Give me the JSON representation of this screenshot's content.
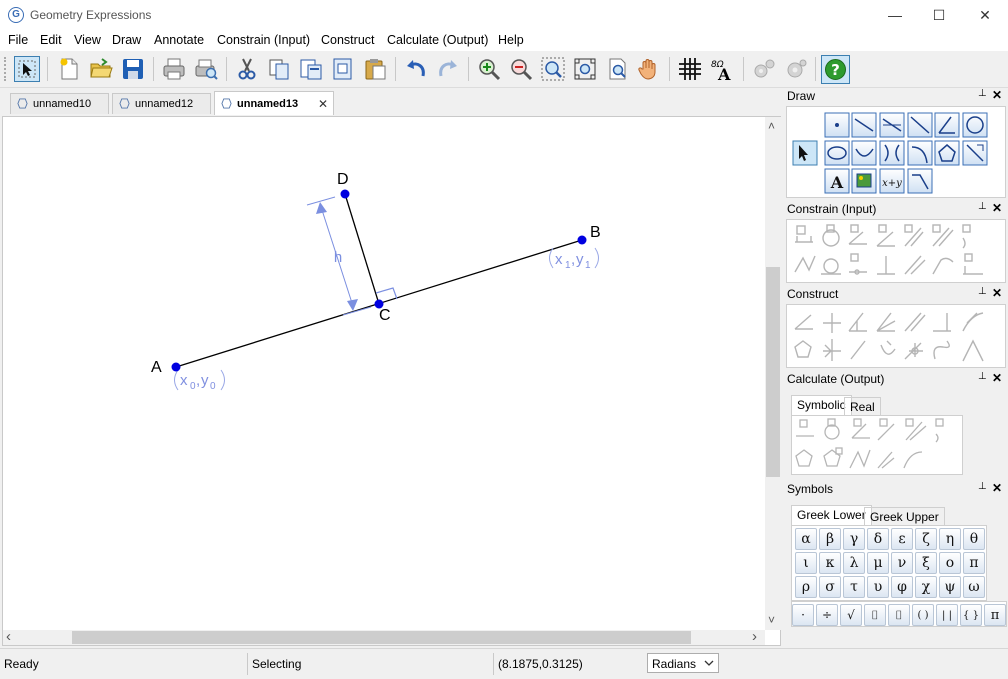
{
  "window": {
    "title": "Geometry Expressions",
    "minimize": "—",
    "maximize": "☐",
    "close": "✕",
    "app_icon_glyph": "G"
  },
  "menu": [
    "File",
    "Edit",
    "View",
    "Draw",
    "Annotate",
    "Constrain (Input)",
    "Construct",
    "Calculate (Output)",
    "Help"
  ],
  "toolbar_icons": [
    "pointer-icon",
    "new-file-icon",
    "open-folder-icon",
    "save-icon",
    "print-icon",
    "print-preview-icon",
    "cut-icon",
    "copy-icon",
    "copy-as-icon",
    "paste-special-icon",
    "paste-icon",
    "undo-icon",
    "redo-icon",
    "zoom-in-icon",
    "zoom-out-icon",
    "zoom-box-icon",
    "zoom-fit-icon",
    "zoom-page-icon",
    "pan-hand-icon",
    "grid-icon",
    "text-style-icon",
    "settings-icon",
    "settings-alt-icon",
    "help-icon"
  ],
  "tabs": [
    {
      "label": "unnamed10",
      "active": false
    },
    {
      "label": "unnamed12",
      "active": false
    },
    {
      "label": "unnamed13",
      "active": true,
      "close": "✕"
    }
  ],
  "drawing": {
    "points": {
      "A": "A",
      "B": "B",
      "C": "C",
      "D": "D"
    },
    "height_label": "h",
    "coord_b": {
      "x": "x",
      "y": "y",
      "sub": "1"
    },
    "coord_a": {
      "x": "x",
      "y": "y",
      "sub": "0"
    },
    "line_color": "#000000",
    "point_color": "#0000e0",
    "annotation_color": "#7b8fe0"
  },
  "scroll": {
    "left_arrow": "‹",
    "right_arrow": "›",
    "up_arrow": "˄",
    "down_arrow": "˅"
  },
  "panels": {
    "draw": {
      "title": "Draw"
    },
    "constrain": {
      "title": "Constrain (Input)"
    },
    "construct": {
      "title": "Construct"
    },
    "calculate": {
      "title": "Calculate (Output)",
      "tabs": [
        "Symbolic",
        "Real"
      ]
    },
    "symbols": {
      "title": "Symbols",
      "tabs": [
        "Greek Lower",
        "Greek Upper"
      ],
      "rows": [
        [
          "α",
          "β",
          "γ",
          "δ",
          "ε",
          "ζ",
          "η",
          "θ"
        ],
        [
          "ι",
          "κ",
          "λ",
          "μ",
          "ν",
          "ξ",
          "ο",
          "π"
        ],
        [
          "ρ",
          "σ",
          "τ",
          "υ",
          "φ",
          "χ",
          "ψ",
          "ω"
        ]
      ],
      "math": [
        "·",
        "÷",
        "√",
        "⌷",
        "⌷",
        "( )",
        "| |",
        "{ }",
        "π"
      ]
    },
    "pin": "📌",
    "x": "✕"
  },
  "status": {
    "ready": "Ready",
    "mode": "Selecting",
    "coords": "(8.1875,0.3125)",
    "angle_unit": "Radians"
  }
}
